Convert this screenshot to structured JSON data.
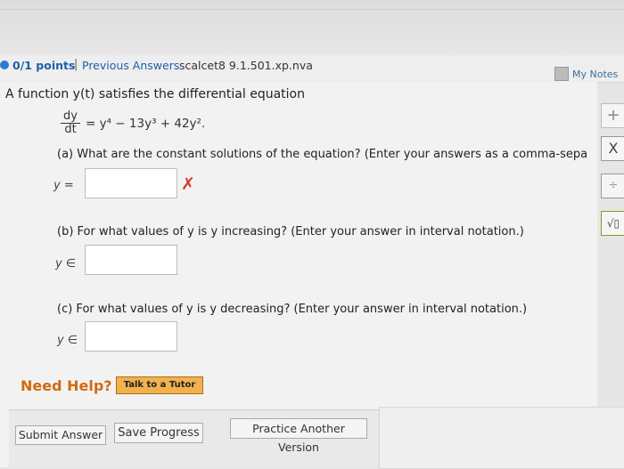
{
  "header": {
    "points": "0/1 points",
    "separator": "|",
    "previous_answers": "Previous Answers",
    "problem_id": "scalcet8 9.1.501.xp.nva",
    "my_notes": "My Notes"
  },
  "question": {
    "intro": "A function y(t) satisfies the differential equation",
    "deriv_num": "dy",
    "deriv_den": "dt",
    "equation_rhs": "= y⁴ − 13y³ + 42y².",
    "part_a": "(a) What are the constant solutions of the equation? (Enter your answers as a comma-sepa",
    "part_a_label": "y =",
    "part_b": "(b) For what values of y is y increasing? (Enter your answer in interval notation.)",
    "part_b_label": "y ∈",
    "part_c": "(c) For what values of y is y decreasing? (Enter your answer in interval notation.)",
    "part_c_label": "y ∈",
    "wrong_mark": "✗"
  },
  "help": {
    "need_help": "Need Help?",
    "talk_to_tutor": "Talk to a Tutor"
  },
  "footer": {
    "submit": "Submit Answer",
    "save": "Save Progress",
    "practice": "Practice Another Version"
  },
  "side_buttons": {
    "plus": "+",
    "close": "X",
    "fraction": "÷",
    "sqrt": "√▯"
  }
}
